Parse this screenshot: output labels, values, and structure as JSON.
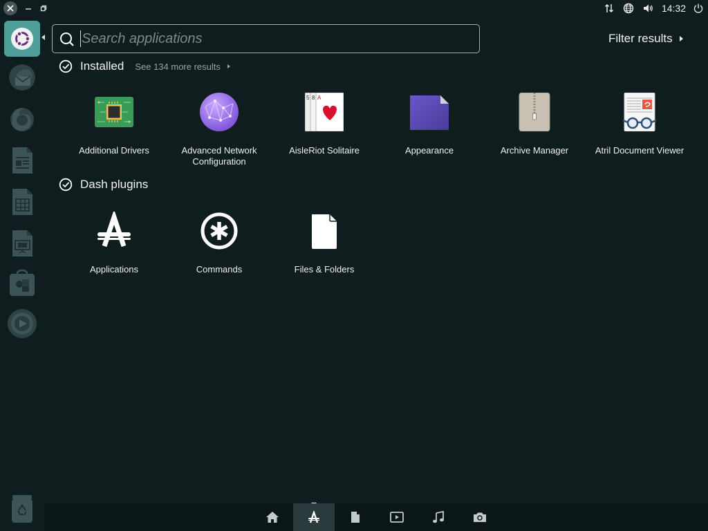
{
  "window": {
    "close_icon": "close-icon",
    "minimize_icon": "minimize-icon",
    "restore_icon": "restore-icon"
  },
  "panel": {
    "clock": "14:32",
    "indicators": [
      "network-transfer-icon",
      "globe-icon",
      "volume-icon",
      "power-icon"
    ]
  },
  "launcher": {
    "items": [
      {
        "name": "dash-home",
        "icon": "ubuntu-logo-icon",
        "active": true
      },
      {
        "name": "thunderbird",
        "icon": "thunderbird-icon"
      },
      {
        "name": "firefox",
        "icon": "firefox-icon"
      },
      {
        "name": "writer",
        "icon": "writer-icon"
      },
      {
        "name": "calc",
        "icon": "calc-icon"
      },
      {
        "name": "impress",
        "icon": "impress-icon"
      },
      {
        "name": "software",
        "icon": "software-center-icon"
      },
      {
        "name": "rhythmbox",
        "icon": "media-player-icon"
      },
      {
        "name": "trash",
        "icon": "trash-icon"
      }
    ]
  },
  "search": {
    "placeholder": "Search applications",
    "value": ""
  },
  "filter_results": {
    "label": "Filter results"
  },
  "sections": {
    "installed": {
      "title": "Installed",
      "see_more": "See 134 more results",
      "apps": [
        {
          "label": "Additional Drivers",
          "icon": "chip-icon"
        },
        {
          "label": "Advanced Network Configuration",
          "icon": "network-globe-icon"
        },
        {
          "label": "AisleRiot Solitaire",
          "icon": "playing-cards-icon"
        },
        {
          "label": "Appearance",
          "icon": "appearance-icon"
        },
        {
          "label": "Archive Manager",
          "icon": "archive-icon"
        },
        {
          "label": "Atril Document Viewer",
          "icon": "document-viewer-icon"
        }
      ]
    },
    "dash_plugins": {
      "title": "Dash plugins",
      "plugins": [
        {
          "label": "Applications",
          "icon": "applications-lens-icon"
        },
        {
          "label": "Commands",
          "icon": "commands-icon"
        },
        {
          "label": "Files & Folders",
          "icon": "file-icon"
        }
      ]
    }
  },
  "lenses": [
    {
      "name": "home",
      "icon": "home-icon"
    },
    {
      "name": "applications",
      "icon": "applications-icon",
      "active": true
    },
    {
      "name": "files",
      "icon": "file-icon"
    },
    {
      "name": "video",
      "icon": "video-icon"
    },
    {
      "name": "music",
      "icon": "music-icon"
    },
    {
      "name": "photos",
      "icon": "camera-icon"
    }
  ],
  "colors": {
    "background": "#0f1d1f",
    "accent": "#4e9f9a"
  }
}
